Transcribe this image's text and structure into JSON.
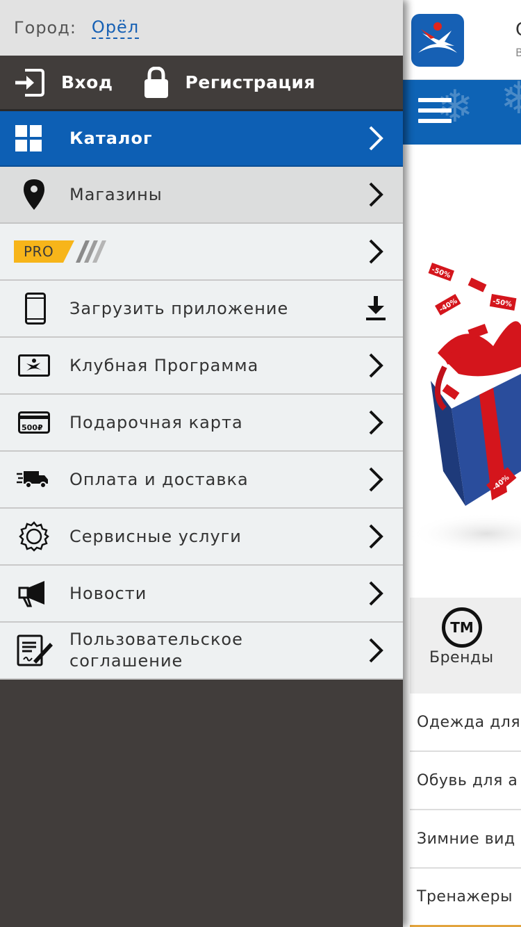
{
  "drawer": {
    "city": {
      "label": "Город:",
      "value": "Орёл"
    },
    "auth": {
      "login_label": "Вход",
      "register_label": "Регистрация"
    },
    "menu": [
      {
        "label": "Каталог",
        "icon": "grid-icon",
        "action": "chevron"
      },
      {
        "label": "Магазины",
        "icon": "location-pin-icon",
        "action": "chevron"
      },
      {
        "label": "PRO",
        "icon": "pro-badge",
        "action": "chevron"
      },
      {
        "label": "Загрузить приложение",
        "icon": "smartphone-icon",
        "action": "download"
      },
      {
        "label": "Клубная Программа",
        "icon": "club-card-icon",
        "action": "chevron"
      },
      {
        "label": "Подарочная карта",
        "icon": "gift-card-icon",
        "action": "chevron"
      },
      {
        "label": "Оплата и доставка",
        "icon": "delivery-truck-icon",
        "action": "chevron"
      },
      {
        "label": "Сервисные услуги",
        "icon": "gear-icon",
        "action": "chevron"
      },
      {
        "label": "Новости",
        "icon": "megaphone-icon",
        "action": "chevron"
      },
      {
        "label": "Пользовательское соглашение",
        "icon": "agreement-icon",
        "action": "chevron"
      }
    ],
    "gift_card_value": "500₽"
  },
  "page": {
    "header_title": "С",
    "header_sub": "В",
    "promo_tags": [
      "-50%",
      "-40%",
      "-50%",
      "-40%"
    ],
    "brands_label": "Бренды",
    "brands_icon_text": "ТМ",
    "categories": [
      "Одежда для",
      "Обувь для а",
      "Зимние вид",
      "Тренажеры"
    ]
  },
  "colors": {
    "brand_blue": "#0d5fb4",
    "drawer_dark": "#413d3b",
    "pro_yellow": "#f7b51a",
    "city_link": "#1660b4"
  }
}
